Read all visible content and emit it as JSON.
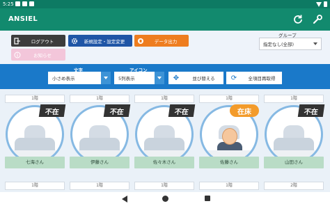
{
  "status": {
    "time": "5:25"
  },
  "app": {
    "title": "ANSIEL"
  },
  "toolbar": {
    "logout_label": "ログアウト",
    "settings_label": "新規設定・設定変更",
    "export_label": "データ出力",
    "notice_label": "お知らせ",
    "group_label": "グループ",
    "group_value": "指定なし(全部)"
  },
  "controls": {
    "text_label": "文字",
    "text_value": "小さめ表示",
    "icon_label": "アイコン",
    "icon_value": "5列表示",
    "sort_label": "並び替える",
    "reload_label": "全項目再取得"
  },
  "rooms": [
    {
      "floor": "1階",
      "status": "不在",
      "name": "七海さん"
    },
    {
      "floor": "1階",
      "status": "不在",
      "name": "伊藤さん"
    },
    {
      "floor": "1階",
      "status": "不在",
      "name": "佐々木さん"
    },
    {
      "floor": "1階",
      "status": "在床",
      "name": "佐藤さん"
    },
    {
      "floor": "1階",
      "status": "不在",
      "name": "山田さん"
    }
  ],
  "rooms_row2": [
    {
      "floor": "1階"
    },
    {
      "floor": "1階"
    },
    {
      "floor": "1階"
    },
    {
      "floor": "1階"
    },
    {
      "floor": "2階"
    }
  ],
  "colors": {
    "app_bar": "#128a6e",
    "control_bar": "#1a79c9",
    "absent_badge": "#333333",
    "inbed_badge": "#f39b2b",
    "name_plate": "#b9dcc6"
  }
}
